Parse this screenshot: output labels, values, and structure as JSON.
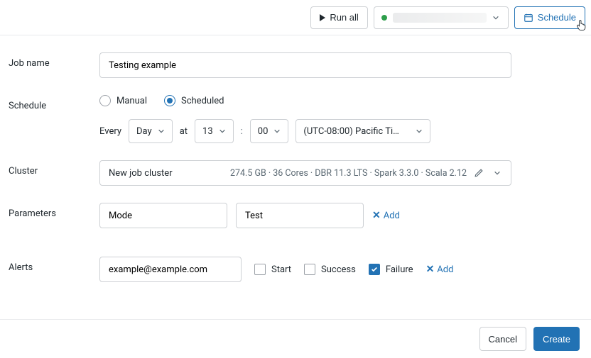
{
  "topbar": {
    "run_all": "Run all",
    "schedule": "Schedule"
  },
  "form": {
    "job_name_label": "Job name",
    "job_name_value": "Testing example",
    "schedule_label": "Schedule",
    "schedule_mode": {
      "manual": "Manual",
      "scheduled": "Scheduled",
      "selected": "scheduled"
    },
    "schedule_rule": {
      "every": "Every",
      "unit": "Day",
      "at": "at",
      "hour": "13",
      "colon": ":",
      "minute": "00",
      "timezone": "(UTC-08:00) Pacific Ti…"
    },
    "cluster_label": "Cluster",
    "cluster": {
      "name": "New job cluster",
      "specs": "274.5 GB · 36 Cores · DBR 11.3 LTS · Spark 3.3.0 · Scala 2.12"
    },
    "parameters_label": "Parameters",
    "parameters": [
      {
        "key": "Mode",
        "value": "Test"
      }
    ],
    "add_param": "Add",
    "alerts_label": "Alerts",
    "alerts": {
      "email": "example@example.com",
      "start": "Start",
      "success": "Success",
      "failure": "Failure",
      "checked": [
        "failure"
      ],
      "add": "Add"
    }
  },
  "footer": {
    "cancel": "Cancel",
    "create": "Create"
  }
}
